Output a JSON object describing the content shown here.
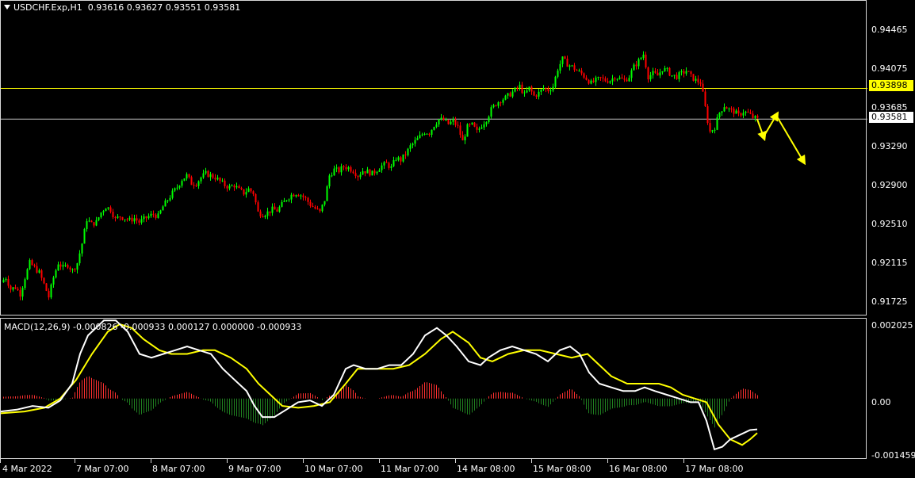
{
  "main_header": {
    "menu_icon": "triangle-down-icon",
    "symbol": "USDCHF.Exp,H1",
    "open": "0.93616",
    "high": "0.93627",
    "low": "0.93551",
    "close": "0.93581"
  },
  "macd_header": {
    "name": "MACD(12,26,9)",
    "values": "-0.000826 -0.000933 0.000127 0.000000 -0.000933"
  },
  "price_axis": [
    "0.94465",
    "0.94075",
    "0.93685",
    "0.93290",
    "0.92900",
    "0.92510",
    "0.92115",
    "0.91725"
  ],
  "macd_axis": [
    "0.002025",
    "0.00",
    "-0.001459"
  ],
  "hline_yellow": {
    "value": "0.93898",
    "color": "#ffff00"
  },
  "hline_bid": {
    "value": "0.93581",
    "color": "#c0c0c0"
  },
  "time_axis": [
    "4 Mar 2022",
    "7 Mar 07:00",
    "8 Mar 07:00",
    "9 Mar 07:00",
    "10 Mar 07:00",
    "11 Mar 07:00",
    "14 Mar 08:00",
    "15 Mar 08:00",
    "16 Mar 08:00",
    "17 Mar 08:00"
  ],
  "colors": {
    "background": "#000000",
    "bull_candle": "#00ff00",
    "bear_candle": "#ff0000",
    "macd_line": "#ffffff",
    "signal_line": "#ffff00",
    "hist_pos": "#ff3030",
    "hist_neg": "#208020",
    "arrows": "#ffff00"
  },
  "chart_data": {
    "type": "candlestick",
    "symbol": "USDCHF.Exp",
    "timeframe": "H1",
    "y_range": [
      0.9155,
      0.948
    ],
    "x_ticks": [
      "4 Mar 2022",
      "7 Mar 07:00",
      "8 Mar 07:00",
      "9 Mar 07:00",
      "10 Mar 07:00",
      "11 Mar 07:00",
      "14 Mar 08:00",
      "15 Mar 08:00",
      "16 Mar 08:00",
      "17 Mar 08:00"
    ],
    "close_path": [
      [
        0,
        0.919
      ],
      [
        6,
        0.9195
      ],
      [
        12,
        0.9183
      ],
      [
        18,
        0.9185
      ],
      [
        24,
        0.9178
      ],
      [
        30,
        0.9195
      ],
      [
        36,
        0.921
      ],
      [
        42,
        0.9205
      ],
      [
        48,
        0.92
      ],
      [
        54,
        0.9188
      ],
      [
        60,
        0.9175
      ],
      [
        66,
        0.9195
      ],
      [
        72,
        0.921
      ],
      [
        78,
        0.9205
      ],
      [
        84,
        0.9208
      ],
      [
        90,
        0.9202
      ],
      [
        96,
        0.921
      ],
      [
        102,
        0.923
      ],
      [
        108,
        0.9255
      ],
      [
        114,
        0.925
      ],
      [
        120,
        0.9252
      ],
      [
        126,
        0.9262
      ],
      [
        132,
        0.9268
      ],
      [
        138,
        0.9265
      ],
      [
        144,
        0.9255
      ],
      [
        150,
        0.9258
      ],
      [
        156,
        0.9256
      ],
      [
        162,
        0.9254
      ],
      [
        168,
        0.9256
      ],
      [
        174,
        0.9252
      ],
      [
        180,
        0.9255
      ],
      [
        186,
        0.9258
      ],
      [
        192,
        0.926
      ],
      [
        198,
        0.9258
      ],
      [
        204,
        0.9268
      ],
      [
        210,
        0.9275
      ],
      [
        216,
        0.9282
      ],
      [
        222,
        0.9288
      ],
      [
        228,
        0.9296
      ],
      [
        234,
        0.93
      ],
      [
        240,
        0.9292
      ],
      [
        246,
        0.9292
      ],
      [
        252,
        0.9298
      ],
      [
        258,
        0.9302
      ],
      [
        264,
        0.93
      ],
      [
        270,
        0.9298
      ],
      [
        276,
        0.9294
      ],
      [
        282,
        0.929
      ],
      [
        288,
        0.9288
      ],
      [
        294,
        0.929
      ],
      [
        300,
        0.9285
      ],
      [
        306,
        0.9282
      ],
      [
        312,
        0.9286
      ],
      [
        318,
        0.9282
      ],
      [
        324,
        0.9262
      ],
      [
        330,
        0.926
      ],
      [
        336,
        0.9262
      ],
      [
        342,
        0.9265
      ],
      [
        348,
        0.9264
      ],
      [
        354,
        0.927
      ],
      [
        360,
        0.9276
      ],
      [
        366,
        0.928
      ],
      [
        372,
        0.9282
      ],
      [
        378,
        0.928
      ],
      [
        384,
        0.9276
      ],
      [
        390,
        0.927
      ],
      [
        396,
        0.9266
      ],
      [
        402,
        0.9262
      ],
      [
        408,
        0.9275
      ],
      [
        414,
        0.93
      ],
      [
        420,
        0.9306
      ],
      [
        426,
        0.9305
      ],
      [
        432,
        0.9309
      ],
      [
        438,
        0.9308
      ],
      [
        444,
        0.9305
      ],
      [
        450,
        0.93
      ],
      [
        456,
        0.9305
      ],
      [
        462,
        0.9304
      ],
      [
        468,
        0.9302
      ],
      [
        474,
        0.9306
      ],
      [
        480,
        0.931
      ],
      [
        486,
        0.9312
      ],
      [
        492,
        0.9308
      ],
      [
        498,
        0.9318
      ],
      [
        504,
        0.9316
      ],
      [
        510,
        0.9322
      ],
      [
        516,
        0.933
      ],
      [
        522,
        0.9335
      ],
      [
        528,
        0.934
      ],
      [
        534,
        0.9345
      ],
      [
        540,
        0.9344
      ],
      [
        546,
        0.9352
      ],
      [
        552,
        0.9358
      ],
      [
        558,
        0.9357
      ],
      [
        564,
        0.9353
      ],
      [
        570,
        0.9356
      ],
      [
        576,
        0.935
      ],
      [
        582,
        0.9335
      ],
      [
        588,
        0.935
      ],
      [
        594,
        0.9352
      ],
      [
        600,
        0.9345
      ],
      [
        606,
        0.9352
      ],
      [
        612,
        0.9358
      ],
      [
        618,
        0.9368
      ],
      [
        624,
        0.9374
      ],
      [
        630,
        0.9378
      ],
      [
        636,
        0.938
      ],
      [
        642,
        0.9384
      ],
      [
        648,
        0.9388
      ],
      [
        654,
        0.9392
      ],
      [
        660,
        0.9383
      ],
      [
        666,
        0.939
      ],
      [
        672,
        0.9382
      ],
      [
        678,
        0.9385
      ],
      [
        684,
        0.939
      ],
      [
        690,
        0.9388
      ],
      [
        696,
        0.9392
      ],
      [
        702,
        0.941
      ],
      [
        708,
        0.942
      ],
      [
        714,
        0.9415
      ],
      [
        720,
        0.9412
      ],
      [
        726,
        0.9408
      ],
      [
        732,
        0.9405
      ],
      [
        738,
        0.94
      ],
      [
        744,
        0.9395
      ],
      [
        750,
        0.9398
      ],
      [
        756,
        0.94
      ],
      [
        762,
        0.9398
      ],
      [
        768,
        0.9398
      ],
      [
        774,
        0.9402
      ],
      [
        780,
        0.94
      ],
      [
        786,
        0.9398
      ],
      [
        792,
        0.9402
      ],
      [
        798,
        0.9412
      ],
      [
        804,
        0.9418
      ],
      [
        810,
        0.9425
      ],
      [
        816,
        0.9402
      ],
      [
        822,
        0.9405
      ],
      [
        828,
        0.9403
      ],
      [
        834,
        0.941
      ],
      [
        840,
        0.9408
      ],
      [
        846,
        0.9403
      ],
      [
        852,
        0.9402
      ],
      [
        858,
        0.9405
      ],
      [
        864,
        0.9408
      ],
      [
        870,
        0.9402
      ],
      [
        876,
        0.9398
      ],
      [
        882,
        0.9396
      ],
      [
        886,
        0.938
      ],
      [
        890,
        0.936
      ],
      [
        894,
        0.9345
      ],
      [
        900,
        0.935
      ],
      [
        906,
        0.9365
      ],
      [
        912,
        0.9372
      ],
      [
        918,
        0.9368
      ],
      [
        924,
        0.9366
      ],
      [
        930,
        0.9362
      ],
      [
        936,
        0.9366
      ],
      [
        942,
        0.9364
      ],
      [
        948,
        0.936
      ],
      [
        954,
        0.9358
      ]
    ],
    "horizontal_lines": [
      0.93898,
      0.93581
    ],
    "projection_arrows": [
      {
        "from": [
          954,
          0.9358
        ],
        "to": [
          962,
          0.934
        ]
      },
      {
        "from": [
          962,
          0.934
        ],
        "to": [
          978,
          0.9362
        ]
      },
      {
        "from": [
          978,
          0.9362
        ],
        "to": [
          1012,
          0.9315
        ]
      }
    ]
  },
  "macd_data": {
    "y_range": [
      -0.00165,
      0.00215
    ],
    "macd_line": [
      [
        0,
        -0.00035
      ],
      [
        20,
        -0.0003
      ],
      [
        40,
        -0.0002
      ],
      [
        60,
        -0.00025
      ],
      [
        75,
        -5e-05
      ],
      [
        90,
        0.0004
      ],
      [
        100,
        0.0012
      ],
      [
        110,
        0.0017
      ],
      [
        120,
        0.0019
      ],
      [
        130,
        0.0021
      ],
      [
        145,
        0.0021
      ],
      [
        160,
        0.0018
      ],
      [
        175,
        0.0012
      ],
      [
        190,
        0.0011
      ],
      [
        205,
        0.0012
      ],
      [
        220,
        0.0013
      ],
      [
        235,
        0.0014
      ],
      [
        250,
        0.0013
      ],
      [
        265,
        0.0012
      ],
      [
        280,
        0.0008
      ],
      [
        295,
        0.0005
      ],
      [
        310,
        0.0002
      ],
      [
        320,
        -0.0002
      ],
      [
        330,
        -0.0005
      ],
      [
        345,
        -0.0005
      ],
      [
        360,
        -0.0003
      ],
      [
        375,
        -0.0001
      ],
      [
        390,
        -5e-05
      ],
      [
        405,
        -0.0002
      ],
      [
        420,
        0.0001
      ],
      [
        435,
        0.0008
      ],
      [
        445,
        0.0009
      ],
      [
        460,
        0.0008
      ],
      [
        475,
        0.0008
      ],
      [
        490,
        0.0009
      ],
      [
        505,
        0.0009
      ],
      [
        520,
        0.0012
      ],
      [
        535,
        0.0017
      ],
      [
        550,
        0.0019
      ],
      [
        562,
        0.0017
      ],
      [
        575,
        0.0014
      ],
      [
        590,
        0.001
      ],
      [
        605,
        0.0009
      ],
      [
        615,
        0.0011
      ],
      [
        630,
        0.0013
      ],
      [
        645,
        0.0014
      ],
      [
        660,
        0.0013
      ],
      [
        675,
        0.0012
      ],
      [
        690,
        0.001
      ],
      [
        705,
        0.0013
      ],
      [
        718,
        0.0014
      ],
      [
        730,
        0.0012
      ],
      [
        742,
        0.0007
      ],
      [
        755,
        0.0004
      ],
      [
        770,
        0.0003
      ],
      [
        785,
        0.0002
      ],
      [
        800,
        0.0002
      ],
      [
        812,
        0.0003
      ],
      [
        825,
        0.0002
      ],
      [
        840,
        0.0001
      ],
      [
        855,
        0.0
      ],
      [
        870,
        -0.0001
      ],
      [
        880,
        -0.0001
      ],
      [
        890,
        -0.0006
      ],
      [
        900,
        -0.00137
      ],
      [
        910,
        -0.0013
      ],
      [
        920,
        -0.0011
      ],
      [
        935,
        -0.00095
      ],
      [
        945,
        -0.00085
      ],
      [
        954,
        -0.00083
      ]
    ],
    "signal_line": [
      [
        0,
        -0.0004
      ],
      [
        30,
        -0.00035
      ],
      [
        55,
        -0.00025
      ],
      [
        75,
        0.0
      ],
      [
        95,
        0.0005
      ],
      [
        115,
        0.0012
      ],
      [
        135,
        0.0018
      ],
      [
        150,
        0.002
      ],
      [
        165,
        0.0019
      ],
      [
        180,
        0.0016
      ],
      [
        200,
        0.0013
      ],
      [
        215,
        0.0012
      ],
      [
        235,
        0.0012
      ],
      [
        255,
        0.0013
      ],
      [
        270,
        0.0013
      ],
      [
        290,
        0.0011
      ],
      [
        310,
        0.0008
      ],
      [
        325,
        0.0004
      ],
      [
        340,
        0.0001
      ],
      [
        355,
        -0.0002
      ],
      [
        375,
        -0.00025
      ],
      [
        395,
        -0.0002
      ],
      [
        415,
        -0.0001
      ],
      [
        435,
        0.0004
      ],
      [
        450,
        0.0008
      ],
      [
        470,
        0.0008
      ],
      [
        495,
        0.0008
      ],
      [
        515,
        0.0009
      ],
      [
        535,
        0.0012
      ],
      [
        555,
        0.0016
      ],
      [
        570,
        0.0018
      ],
      [
        590,
        0.0015
      ],
      [
        605,
        0.0011
      ],
      [
        620,
        0.001
      ],
      [
        640,
        0.0012
      ],
      [
        660,
        0.0013
      ],
      [
        680,
        0.0013
      ],
      [
        700,
        0.0012
      ],
      [
        720,
        0.0011
      ],
      [
        740,
        0.0012
      ],
      [
        755,
        0.0009
      ],
      [
        770,
        0.0006
      ],
      [
        790,
        0.0004
      ],
      [
        810,
        0.0004
      ],
      [
        830,
        0.0004
      ],
      [
        845,
        0.0003
      ],
      [
        860,
        0.0001
      ],
      [
        875,
        0.0
      ],
      [
        890,
        -0.0001
      ],
      [
        905,
        -0.0007
      ],
      [
        920,
        -0.0011
      ],
      [
        935,
        -0.00125
      ],
      [
        945,
        -0.0011
      ],
      [
        954,
        -0.00093
      ]
    ]
  }
}
